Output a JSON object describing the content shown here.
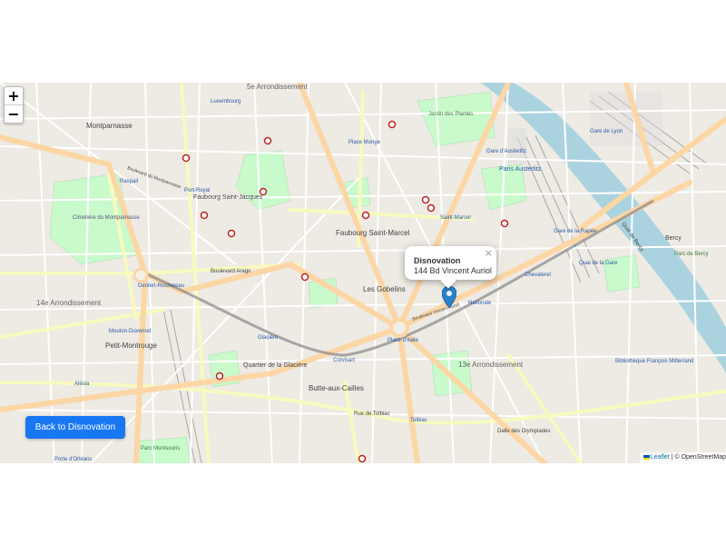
{
  "map": {
    "zoom_in_label": "+",
    "zoom_out_label": "−",
    "popup": {
      "title": "Disnovation",
      "address": "144 Bd Vincent Auriol",
      "close_label": "×"
    },
    "back_button_label": "Back to Disnovation",
    "attribution": {
      "leaflet": "Leaflet",
      "separator": " | © OpenStreetMap"
    },
    "labels": {
      "montparnasse": "Montparnasse",
      "arrondissement_14": "14e Arrondissement",
      "arrondissement_13": "13e Arrondissement",
      "cimetiere": "Cimetière du Montparnasse",
      "faubourg_saint_jacques": "Faubourg Saint-Jacques",
      "faubourg_saint_marcel": "Faubourg Saint-Marcel",
      "les_gobelins": "Les Gobelins",
      "place_monge": "Place Monge",
      "paris_austerlitz": "Paris Austerlitz",
      "gare_de_lyon": "Gare de Lyon",
      "bercy": "Bercy",
      "petit_montrouge": "Petit-Montrouge",
      "quartier_glaciere": "Quartier de la Glacière",
      "butte_aux_cailles": "Butte-aux-Cailles",
      "place_italie": "Place d'Italie",
      "gare_de_la_rapee": "Gare de la Rapée",
      "bibliotheque": "Bibliothèque François Mitterrand",
      "jardin_des_plantes": "Jardin des Plantes",
      "denfert": "Denfert-Rochereau",
      "port_royal": "Port-Royal",
      "boulevard_arago": "Boulevard Arago",
      "rue_de_tolbiac": "Rue de Tolbiac",
      "boulevard_vincent_auriol": "Boulevard Vincent Auriol",
      "dalle_olympiades": "Dalle des Olympiades",
      "parc_de_bercy": "Parc de Bercy",
      "quai_de_bercy": "Quai de Bercy",
      "gare_austerlitz": "Gare d'Austerlitz",
      "saint_marcel": "Saint-Marcel",
      "nationale": "Nationale",
      "tolbiac": "Tolbiac",
      "glaciere": "Glacière",
      "corvisart": "Corvisart",
      "chevaleret": "Chevaleret",
      "quai_de_la_gare": "Quai de la Gare",
      "arrondissement_5": "5e Arrondissement",
      "luxembourg": "Luxembourg",
      "bd_montparnasse": "Boulevard du Montparnasse",
      "raspail": "Raspail",
      "mouton_duvernet": "Mouton-Duvernet",
      "parc_montsouris": "Parc Montsouris",
      "alesia": "Alésia",
      "porte_orleans": "Porte d'Orléans"
    }
  },
  "colors": {
    "land": "#f2efe9",
    "road_major": "#fcd6a4",
    "road_secondary": "#f7fabf",
    "road_minor": "#ffffff",
    "park": "#c8facc",
    "water": "#aad3df",
    "rail": "#999999",
    "marker": "#2a81cb",
    "button": "#1877f2"
  }
}
